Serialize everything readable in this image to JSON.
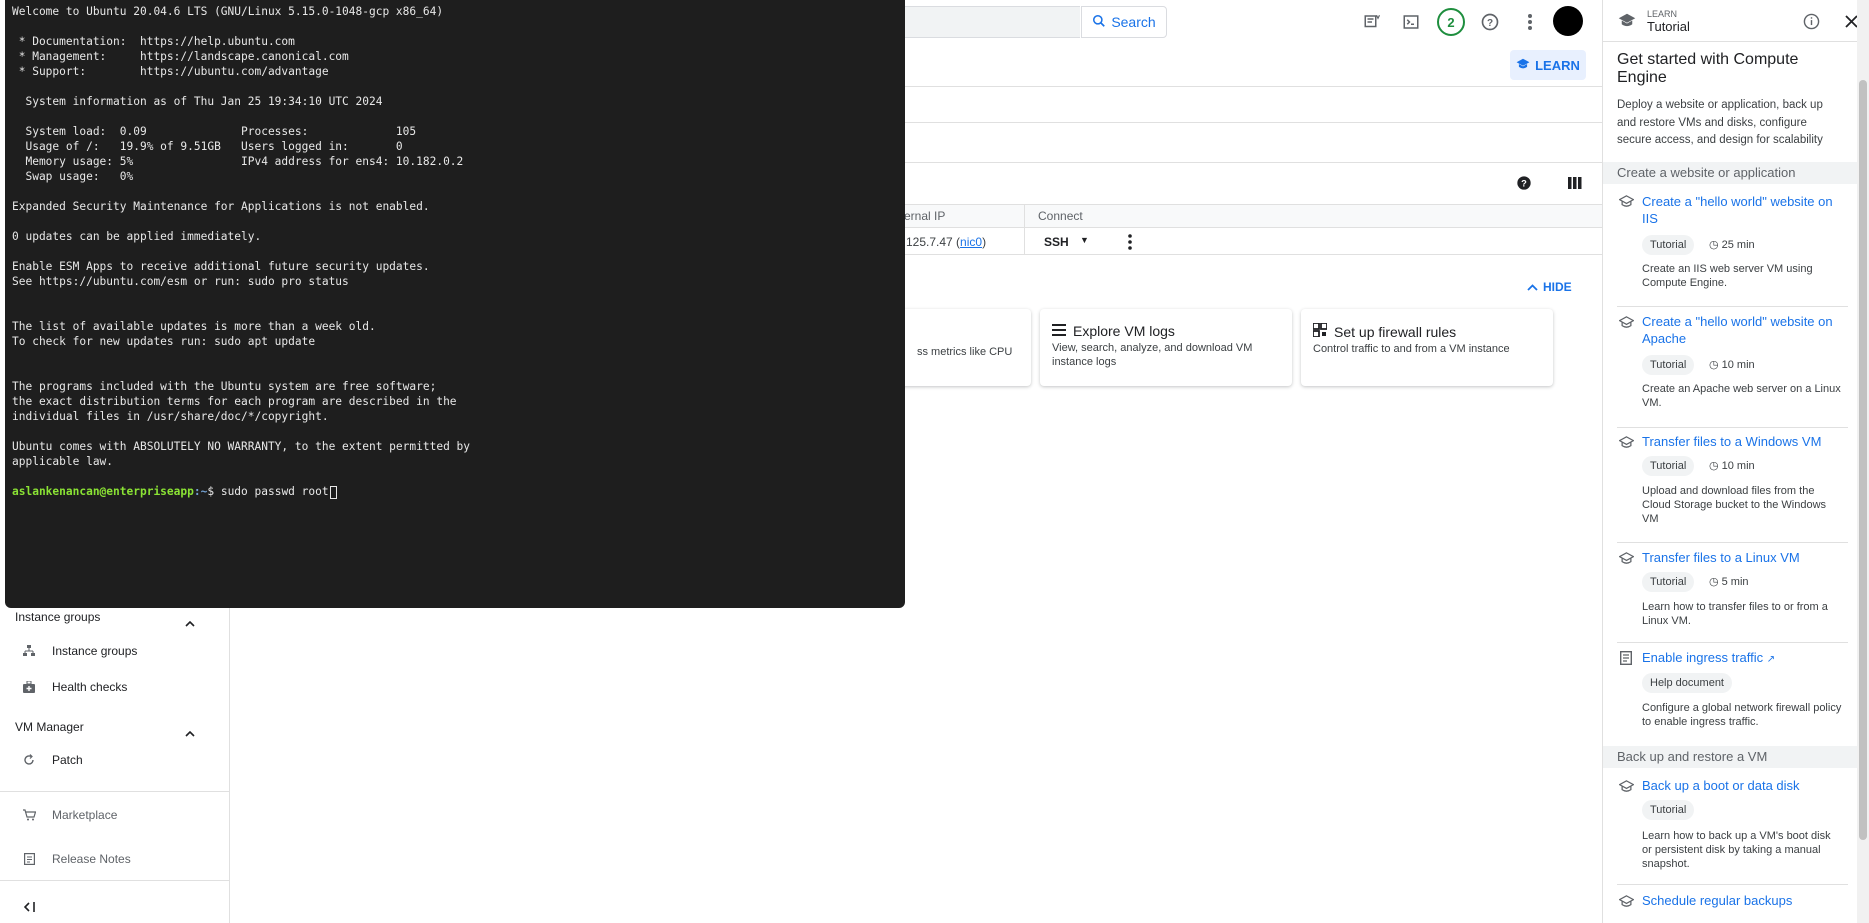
{
  "topbar": {
    "search_label": "Search",
    "notification_count": "2"
  },
  "learn_button": "LEARN",
  "toolbar_icons": [
    "help-icon",
    "columns-icon"
  ],
  "table": {
    "headers": [
      "ernal IP",
      "Connect"
    ],
    "row": {
      "ip": "125.7.47 (",
      "ip_link": "nic0",
      "ip_close": ")",
      "connect": "SSH"
    }
  },
  "hide_button": "HIDE",
  "cards": [
    {
      "title": "",
      "desc": "ss metrics like CPU"
    },
    {
      "title": "Explore VM logs",
      "desc": "View, search, analyze, and download VM instance logs"
    },
    {
      "title": "Set up firewall rules",
      "desc": "Control traffic to and from a VM instance"
    }
  ],
  "leftnav": {
    "instance_groups_header": "Instance groups",
    "instance_groups": "Instance groups",
    "health_checks": "Health checks",
    "vm_manager_header": "VM Manager",
    "patch": "Patch",
    "marketplace": "Marketplace",
    "release_notes": "Release Notes"
  },
  "terminal": {
    "lines": [
      "Welcome to Ubuntu 20.04.6 LTS (GNU/Linux 5.15.0-1048-gcp x86_64)",
      "",
      " * Documentation:  https://help.ubuntu.com",
      " * Management:     https://landscape.canonical.com",
      " * Support:        https://ubuntu.com/advantage",
      "",
      "  System information as of Thu Jan 25 19:34:10 UTC 2024",
      "",
      "  System load:  0.09              Processes:             105",
      "  Usage of /:   19.9% of 9.51GB   Users logged in:       0",
      "  Memory usage: 5%                IPv4 address for ens4: 10.182.0.2",
      "  Swap usage:   0%",
      "",
      "Expanded Security Maintenance for Applications is not enabled.",
      "",
      "0 updates can be applied immediately.",
      "",
      "Enable ESM Apps to receive additional future security updates.",
      "See https://ubuntu.com/esm or run: sudo pro status",
      "",
      "",
      "The list of available updates is more than a week old.",
      "To check for new updates run: sudo apt update",
      "",
      "",
      "The programs included with the Ubuntu system are free software;",
      "the exact distribution terms for each program are described in the",
      "individual files in /usr/share/doc/*/copyright.",
      "",
      "Ubuntu comes with ABSOLUTELY NO WARRANTY, to the extent permitted by",
      "applicable law.",
      ""
    ],
    "prompt_user": "aslankenancan@enterpriseapp",
    "prompt_path": ":~",
    "prompt_symbol": "$ ",
    "command": "sudo passwd root"
  },
  "panel": {
    "kicker": "LEARN",
    "title": "Tutorial",
    "heading": "Get started with Compute Engine",
    "intro": "Deploy a website or application, back up and restore VMs and disks, configure secure access, and design for scalability",
    "section1": "Create a website or application",
    "section2": "Back up and restore a VM",
    "items": [
      {
        "title": "Create a \"hello world\" website on IIS",
        "chip": "Tutorial",
        "duration": "25 min",
        "desc": "Create an IIS web server VM using Compute Engine."
      },
      {
        "title": "Create a \"hello world\" website on Apache",
        "chip": "Tutorial",
        "duration": "10 min",
        "desc": "Create an Apache web server on a Linux VM."
      },
      {
        "title": "Transfer files to a Windows VM",
        "chip": "Tutorial",
        "duration": "10 min",
        "desc": "Upload and download files from the Cloud Storage bucket to the Windows VM"
      },
      {
        "title": "Transfer files to a Linux VM",
        "chip": "Tutorial",
        "duration": "5 min",
        "desc": "Learn how to transfer files to or from a Linux VM."
      },
      {
        "title": "Enable ingress traffic",
        "chip": "Help document",
        "duration": "",
        "desc": "Configure a global network firewall policy to enable ingress traffic."
      },
      {
        "title": "Back up a boot or data disk",
        "chip": "Tutorial",
        "duration": "",
        "desc": "Learn how to back up a VM's boot disk or persistent disk by taking a manual snapshot."
      },
      {
        "title": "Schedule regular backups",
        "chip": "",
        "duration": "",
        "desc": ""
      }
    ]
  },
  "colors": {
    "accent": "#1a73e8",
    "terminal_bg": "#1e1e1e",
    "prompt_green": "#8ae234",
    "prompt_blue": "#729fcf"
  }
}
